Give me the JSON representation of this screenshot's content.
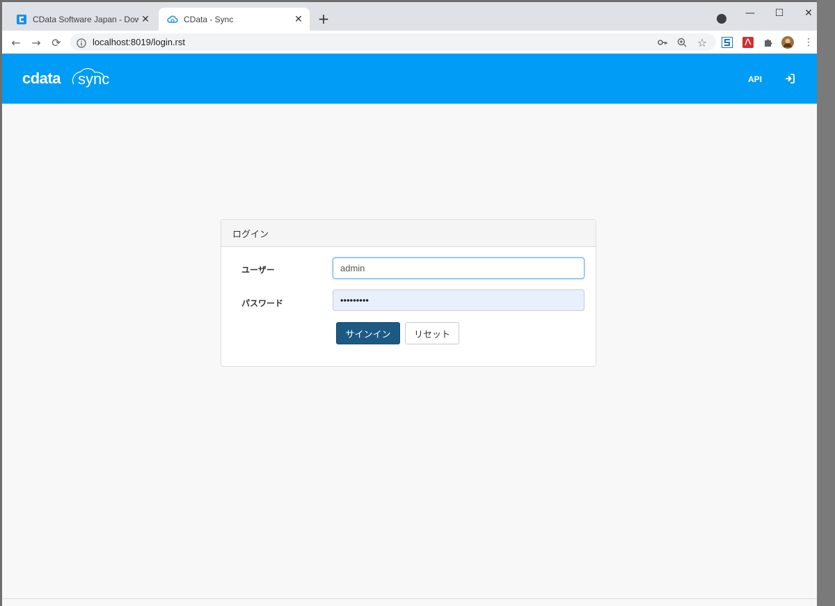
{
  "browser": {
    "tabs": [
      {
        "title": "CData Software Japan - Downloa",
        "favicon": "cdata-favicon",
        "active": false
      },
      {
        "title": "CData - Sync",
        "favicon": "cloud-sync-favicon",
        "active": true
      }
    ],
    "url": "localhost:8019/login.rst",
    "colors": {
      "tabstrip": "#dee1e6",
      "toolbar": "#ffffff"
    }
  },
  "header": {
    "logo_text": "cdata sync",
    "api_label": "API",
    "login_icon": "sign-in-icon",
    "color": "#009cf5"
  },
  "login": {
    "title": "ログイン",
    "user_label": "ユーザー",
    "user_value": "admin",
    "password_label": "パスワード",
    "password_mask": "•••••••••",
    "signin_label": "サインイン",
    "reset_label": "リセット",
    "primary_color": "#1c5a84"
  }
}
